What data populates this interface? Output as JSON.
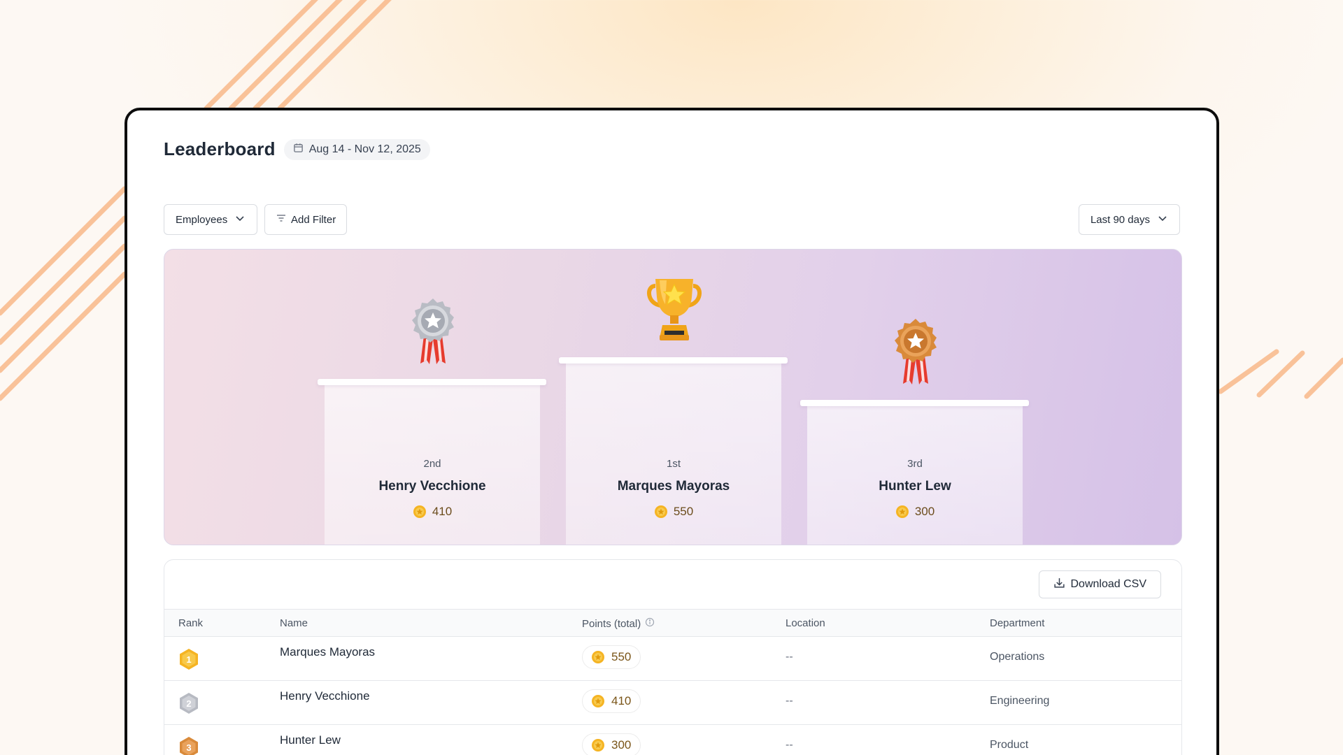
{
  "header": {
    "title": "Leaderboard",
    "date_range": "Aug 14 - Nov 12, 2025"
  },
  "toolbar": {
    "employees_label": "Employees",
    "add_filter_label": "Add Filter",
    "period_label": "Last 90 days"
  },
  "podium": {
    "first": {
      "place": "1st",
      "name": "Marques Mayoras",
      "points": "550"
    },
    "second": {
      "place": "2nd",
      "name": "Henry Vecchione",
      "points": "410"
    },
    "third": {
      "place": "3rd",
      "name": "Hunter Lew",
      "points": "300"
    }
  },
  "table": {
    "download_label": "Download CSV",
    "columns": {
      "rank": "Rank",
      "name": "Name",
      "points": "Points (total)",
      "location": "Location",
      "department": "Department"
    },
    "rows": [
      {
        "rank": "1",
        "name": "Marques Mayoras",
        "points": "550",
        "location": "--",
        "department": "Operations"
      },
      {
        "rank": "2",
        "name": "Henry Vecchione",
        "points": "410",
        "location": "--",
        "department": "Engineering"
      },
      {
        "rank": "3",
        "name": "Hunter Lew",
        "points": "300",
        "location": "--",
        "department": "Product"
      }
    ]
  },
  "colors": {
    "gold": "#f5b423",
    "silver": "#c7c9cf",
    "bronze": "#d98a3a",
    "stripe": "#f9b27a"
  }
}
